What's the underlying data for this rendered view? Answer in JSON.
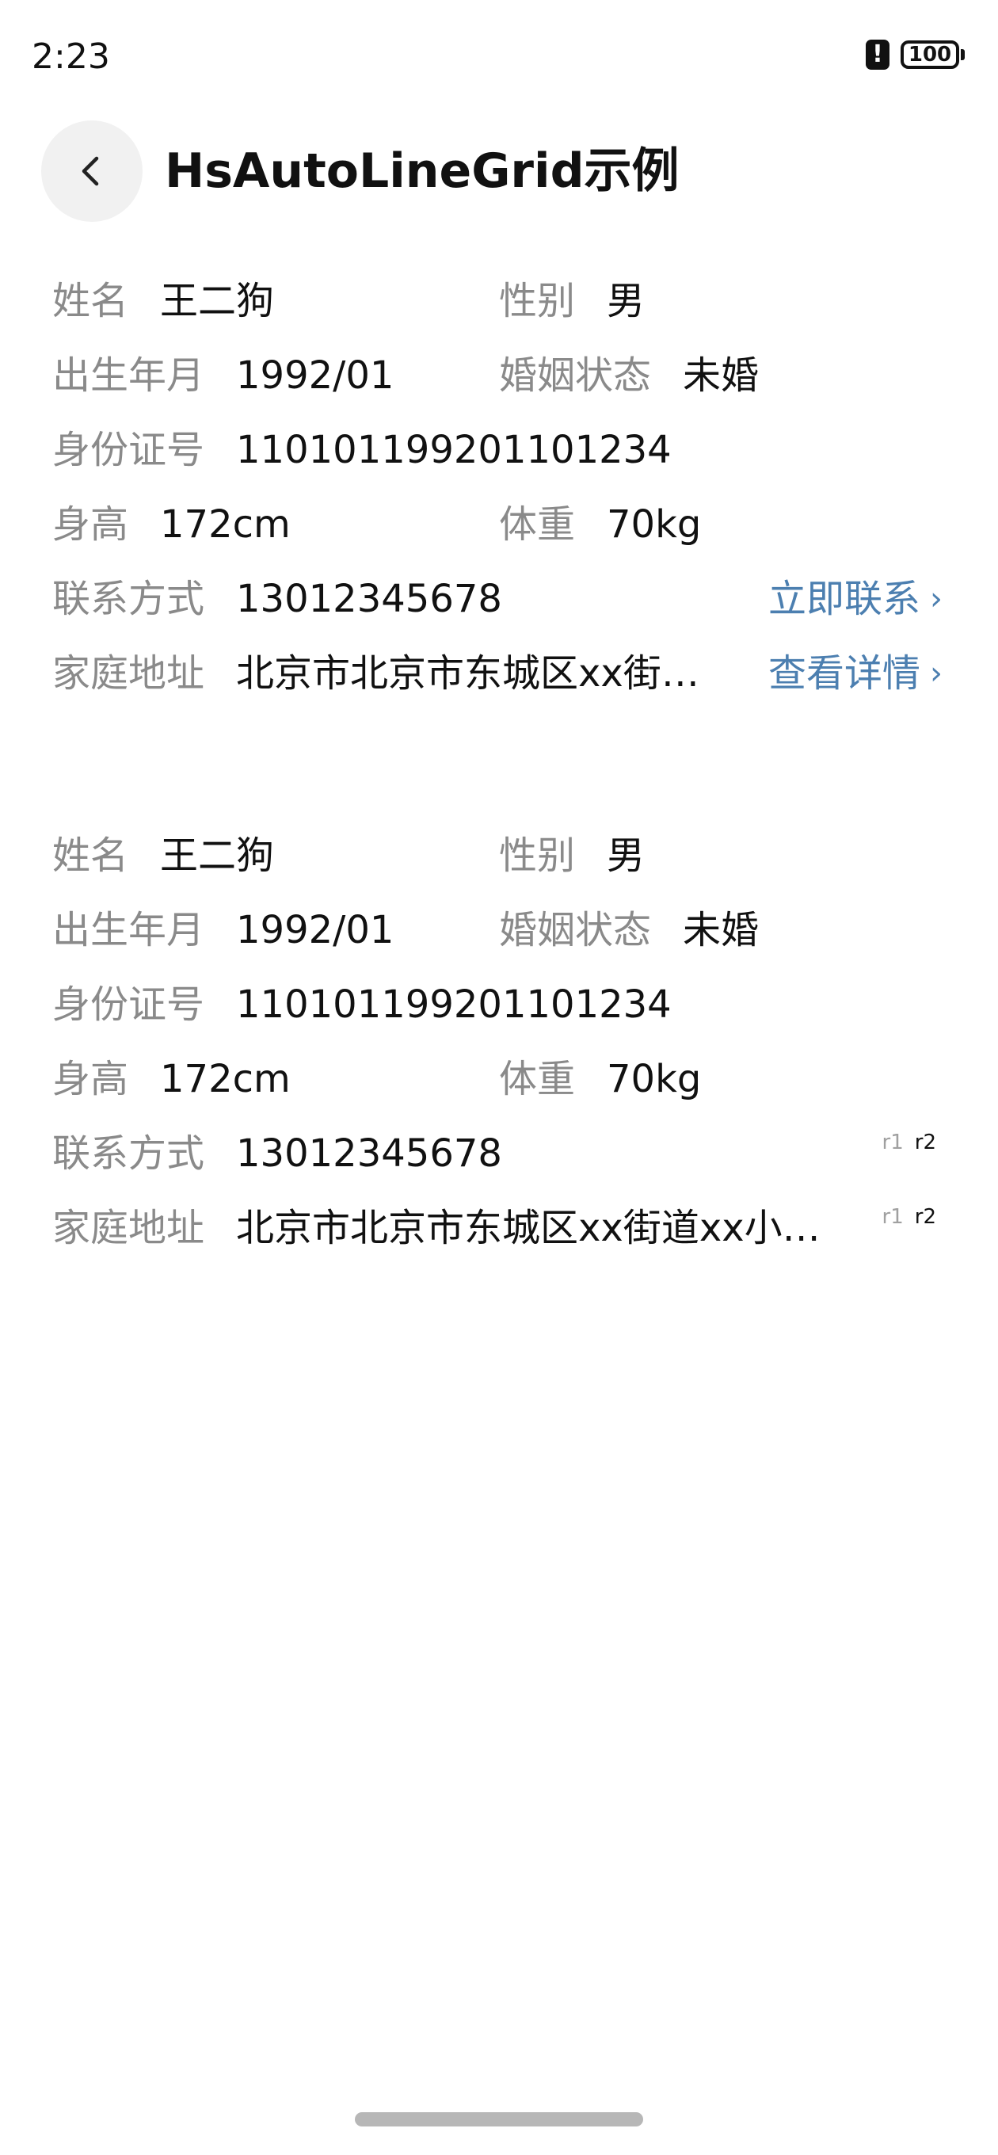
{
  "status_bar": {
    "time": "2:23",
    "alert_icon": "!",
    "battery": "100"
  },
  "header": {
    "title": "HsAutoLineGrid示例"
  },
  "cards": [
    {
      "name": {
        "label": "姓名",
        "value": "王二狗"
      },
      "gender": {
        "label": "性别",
        "value": "男"
      },
      "birth": {
        "label": "出生年月",
        "value": "1992/01"
      },
      "marital": {
        "label": "婚姻状态",
        "value": "未婚"
      },
      "id_number": {
        "label": "身份证号",
        "value": "110101199201101234"
      },
      "height": {
        "label": "身高",
        "value": "172cm"
      },
      "weight": {
        "label": "体重",
        "value": "70kg"
      },
      "phone": {
        "label": "联系方式",
        "value": "13012345678",
        "action": "立即联系"
      },
      "address": {
        "label": "家庭地址",
        "value": "北京市北京市东城区xx街…",
        "action": "查看详情"
      }
    },
    {
      "name": {
        "label": "姓名",
        "value": "王二狗"
      },
      "gender": {
        "label": "性别",
        "value": "男"
      },
      "birth": {
        "label": "出生年月",
        "value": "1992/01"
      },
      "marital": {
        "label": "婚姻状态",
        "value": "未婚"
      },
      "id_number": {
        "label": "身份证号",
        "value": "110101199201101234"
      },
      "height": {
        "label": "身高",
        "value": "172cm"
      },
      "weight": {
        "label": "体重",
        "value": "70kg"
      },
      "phone": {
        "label": "联系方式",
        "value": "13012345678",
        "tag_r1": "r1",
        "tag_r2": "r2"
      },
      "address": {
        "label": "家庭地址",
        "value": "北京市北京市东城区xx街道xx小…",
        "tag_r1": "r1",
        "tag_r2": "r2"
      }
    }
  ],
  "colors": {
    "label": "#8a8a8a",
    "value": "#111111",
    "link": "#4c7fb0",
    "back_button_bg": "#f1f1f1"
  },
  "icons": {
    "back": "chevron-left-icon",
    "link_arrow": "chevron-right-icon"
  }
}
